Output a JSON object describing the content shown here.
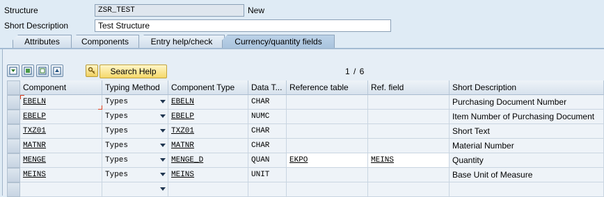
{
  "header": {
    "structure_label": "Structure",
    "structure_value": "ZSR_TEST",
    "status": "New",
    "short_desc_label": "Short Description",
    "short_desc_value": "Test Structure"
  },
  "tabs": [
    {
      "label": "Attributes",
      "active": false
    },
    {
      "label": "Components",
      "active": false
    },
    {
      "label": "Entry help/check",
      "active": false
    },
    {
      "label": "Currency/quantity fields",
      "active": true
    }
  ],
  "toolbar": {
    "search_help_label": "Search Help",
    "page_indicator": "1 / 6"
  },
  "table": {
    "columns": [
      "Component",
      "Typing Method",
      "Component Type",
      "Data T...",
      "Reference table",
      "Ref. field",
      "Short Description"
    ],
    "rows": [
      {
        "component": "EBELN",
        "typing": "Types",
        "ctype": "EBELN",
        "dtype": "CHAR",
        "reftab": "",
        "reffield": "",
        "desc": "Purchasing Document Number"
      },
      {
        "component": "EBELP",
        "typing": "Types",
        "ctype": "EBELP",
        "dtype": "NUMC",
        "reftab": "",
        "reffield": "",
        "desc": "Item Number of Purchasing Document"
      },
      {
        "component": "TXZ01",
        "typing": "Types",
        "ctype": "TXZ01",
        "dtype": "CHAR",
        "reftab": "",
        "reffield": "",
        "desc": "Short Text"
      },
      {
        "component": "MATNR",
        "typing": "Types",
        "ctype": "MATNR",
        "dtype": "CHAR",
        "reftab": "",
        "reffield": "",
        "desc": "Material Number"
      },
      {
        "component": "MENGE",
        "typing": "Types",
        "ctype": "MENGE_D",
        "dtype": "QUAN",
        "reftab": "EKPO",
        "reffield": "MEINS",
        "desc": "Quantity"
      },
      {
        "component": "MEINS",
        "typing": "Types",
        "ctype": "MEINS",
        "dtype": "UNIT",
        "reftab": "",
        "reffield": "",
        "desc": "Base Unit of Measure"
      },
      {
        "component": "",
        "typing": "",
        "ctype": "",
        "dtype": "",
        "reftab": "",
        "reffield": "",
        "desc": ""
      }
    ]
  },
  "icons": [
    "select-all-icon",
    "select-block-icon",
    "deselect-all-icon",
    "move-up-icon",
    "key-icon"
  ]
}
